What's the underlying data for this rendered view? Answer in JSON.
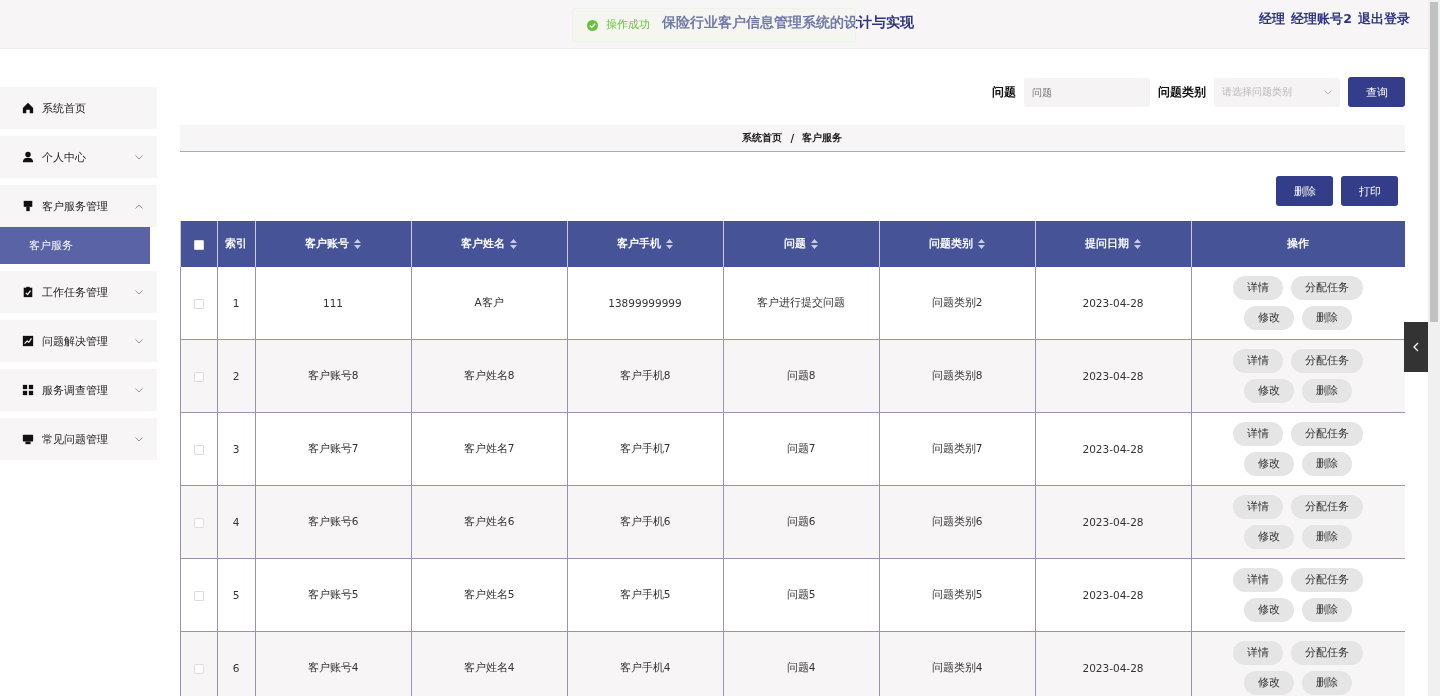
{
  "header": {
    "title": "保险行业客户信息管理系统的设计与实现",
    "user_links": [
      "经理",
      "经理账号2",
      "退出登录"
    ]
  },
  "toast": {
    "message": "操作成功"
  },
  "sidebar": {
    "items": [
      {
        "label": "系统首页",
        "kind": "home",
        "expandable": false
      },
      {
        "label": "个人中心",
        "kind": "user",
        "expandable": true,
        "expanded": false
      },
      {
        "label": "客户服务管理",
        "kind": "service",
        "expandable": true,
        "expanded": true,
        "children": [
          {
            "label": "客户服务",
            "selected": true
          }
        ]
      },
      {
        "label": "工作任务管理",
        "kind": "task",
        "expandable": true,
        "expanded": false
      },
      {
        "label": "问题解决管理",
        "kind": "chart",
        "expandable": true,
        "expanded": false
      },
      {
        "label": "服务调查管理",
        "kind": "grid",
        "expandable": true,
        "expanded": false
      },
      {
        "label": "常见问题管理",
        "kind": "monitor",
        "expandable": true,
        "expanded": false
      }
    ]
  },
  "search": {
    "fields": [
      {
        "label": "问题",
        "placeholder": "问题",
        "kind": "text"
      },
      {
        "label": "问题类别",
        "placeholder": "请选择问题类别",
        "kind": "select"
      }
    ],
    "button": "查询"
  },
  "breadcrumb": [
    "系统首页",
    "/",
    "客户服务"
  ],
  "actions": [
    "删除",
    "打印"
  ],
  "table": {
    "select_all_checked": false,
    "columns": [
      {
        "label": "索引",
        "sortable": false
      },
      {
        "label": "客户账号",
        "sortable": true
      },
      {
        "label": "客户姓名",
        "sortable": true
      },
      {
        "label": "客户手机",
        "sortable": true
      },
      {
        "label": "问题",
        "sortable": true
      },
      {
        "label": "问题类别",
        "sortable": true
      },
      {
        "label": "提问日期",
        "sortable": true
      },
      {
        "label": "操作",
        "sortable": false
      }
    ],
    "rows": [
      {
        "checked": false,
        "cells": [
          "1",
          "111",
          "A客户",
          "13899999999",
          "客户进行提交问题",
          "问题类别2",
          "2023-04-28"
        ],
        "buttons": [
          "详情",
          "分配任务",
          "修改",
          "删除"
        ]
      },
      {
        "checked": false,
        "cells": [
          "2",
          "客户账号8",
          "客户姓名8",
          "客户手机8",
          "问题8",
          "问题类别8",
          "2023-04-28"
        ],
        "buttons": [
          "详情",
          "分配任务",
          "修改",
          "删除"
        ]
      },
      {
        "checked": false,
        "cells": [
          "3",
          "客户账号7",
          "客户姓名7",
          "客户手机7",
          "问题7",
          "问题类别7",
          "2023-04-28"
        ],
        "buttons": [
          "详情",
          "分配任务",
          "修改",
          "删除"
        ]
      },
      {
        "checked": false,
        "cells": [
          "4",
          "客户账号6",
          "客户姓名6",
          "客户手机6",
          "问题6",
          "问题类别6",
          "2023-04-28"
        ],
        "buttons": [
          "详情",
          "分配任务",
          "修改",
          "删除"
        ]
      },
      {
        "checked": false,
        "cells": [
          "5",
          "客户账号5",
          "客户姓名5",
          "客户手机5",
          "问题5",
          "问题类别5",
          "2023-04-28"
        ],
        "buttons": [
          "详情",
          "分配任务",
          "修改",
          "删除"
        ]
      },
      {
        "checked": false,
        "cells": [
          "6",
          "客户账号4",
          "客户姓名4",
          "客户手机4",
          "问题4",
          "问题类别4",
          "2023-04-28"
        ],
        "buttons": [
          "详情",
          "分配任务",
          "修改",
          "删除"
        ]
      }
    ]
  }
}
